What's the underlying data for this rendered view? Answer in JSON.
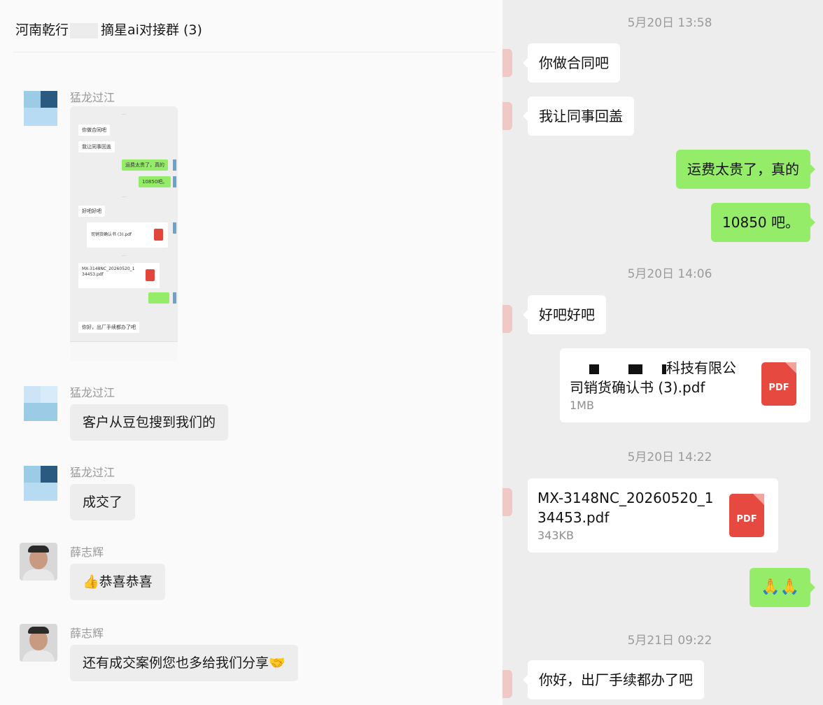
{
  "left": {
    "title": {
      "prefix": "河南乾行",
      "suffix": "摘星ai对接群 (3)"
    },
    "messages": [
      {
        "sender": "猛龙过江"
      },
      {
        "sender": "猛龙过江",
        "text": "客户从豆包搜到我们的"
      },
      {
        "sender": "猛龙过江",
        "text": "成交了"
      },
      {
        "sender": "薛志辉",
        "text": "👍恭喜恭喜"
      },
      {
        "sender": "薛志辉",
        "text": "还有成交案例您也多给我们分享🤝"
      }
    ],
    "mini_screenshot": {
      "b1": "你做合同吧",
      "b2": "我让同事回盖",
      "b3": "运费太贵了，真的",
      "b4": "10850吧。",
      "b5": "好吧好吧",
      "b6": "司销货确认书 (3).pdf",
      "b7": "MX-3148NC_20260520_1",
      "b7b": "34453.pdf",
      "b8": "你好，出厂手续都办了吧"
    }
  },
  "right": {
    "timestamps": [
      "5月20日 13:58",
      "5月20日 14:06",
      "5月20日 14:22",
      "5月21日 09:22"
    ],
    "messages": [
      {
        "side": "left",
        "text": "你做合同吧"
      },
      {
        "side": "left",
        "text": "我让同事回盖"
      },
      {
        "side": "right",
        "text": "运费太贵了，真的"
      },
      {
        "side": "right",
        "text": "10850 吧。"
      },
      {
        "side": "left",
        "text": "好吧好吧"
      },
      {
        "side": "right",
        "file": {
          "name_line1": "科技有限公",
          "name_line2": "司销货确认书 (3).pdf",
          "size": "1MB",
          "icon": "PDF"
        }
      },
      {
        "side": "left",
        "file": {
          "name_line1": "MX-3148NC_20260520_1",
          "name_line2": "34453.pdf",
          "size": "343KB",
          "icon": "PDF"
        }
      },
      {
        "side": "right",
        "emoji": "🙏🙏"
      },
      {
        "side": "left",
        "text": "你好，出厂手续都办了吧"
      }
    ]
  }
}
